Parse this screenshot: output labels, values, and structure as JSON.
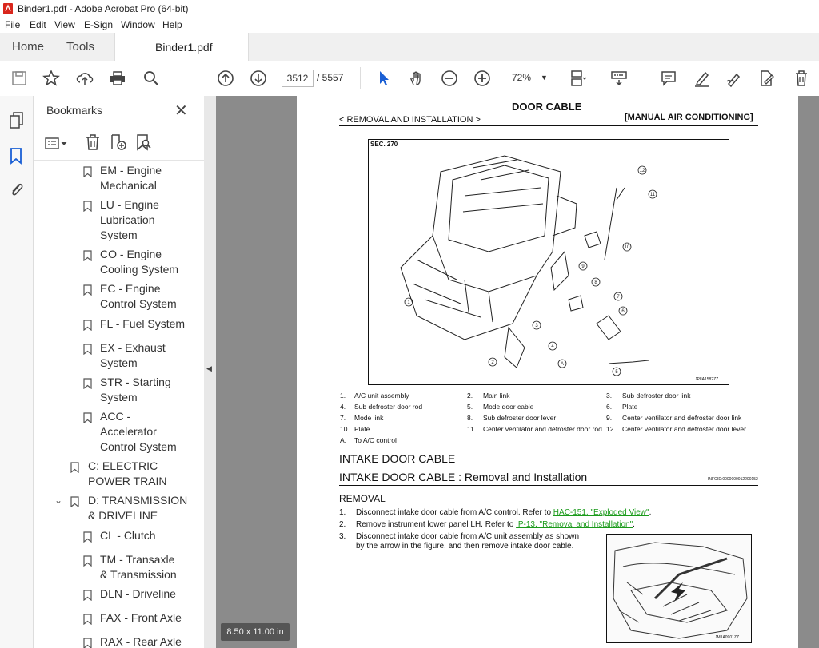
{
  "window": {
    "title": "Binder1.pdf - Adobe Acrobat Pro (64-bit)"
  },
  "menu": [
    "File",
    "Edit",
    "View",
    "E-Sign",
    "Window",
    "Help"
  ],
  "tabs": {
    "home": "Home",
    "tools": "Tools",
    "document": "Binder1.pdf"
  },
  "toolbar": {
    "page_current": "3512",
    "page_total": "/ 5557",
    "zoom": "72%"
  },
  "bookmarks": {
    "title": "Bookmarks",
    "items": [
      {
        "line1": "EM - Engine",
        "line2": "Mechanical"
      },
      {
        "line1": "LU - Engine",
        "line2": "Lubrication",
        "line3": "System"
      },
      {
        "line1": "CO - Engine",
        "line2": "Cooling System"
      },
      {
        "line1": "EC - Engine",
        "line2": "Control System"
      },
      {
        "line1": "FL - Fuel System"
      },
      {
        "line1": "EX - Exhaust",
        "line2": "System"
      },
      {
        "line1": "STR - Starting",
        "line2": "System"
      },
      {
        "line1": "ACC -",
        "line2": "Accelerator",
        "line3": "Control System"
      },
      {
        "line1": "C: ELECTRIC",
        "line2": "POWER TRAIN"
      },
      {
        "line1": "D: TRANSMISSION",
        "line2": "& DRIVELINE"
      },
      {
        "line1": "CL - Clutch"
      },
      {
        "line1": "TM - Transaxle",
        "line2": "& Transmission"
      },
      {
        "line1": "DLN - Driveline"
      },
      {
        "line1": "FAX - Front Axle"
      },
      {
        "line1": "RAX - Rear Axle"
      }
    ]
  },
  "page": {
    "heading": "DOOR CABLE",
    "breadcrumb": "< REMOVAL AND INSTALLATION >",
    "section": "[MANUAL AIR CONDITIONING]",
    "sec_label": "SEC. 270",
    "fig_id": "JPIIA1582ZZ",
    "legend": [
      [
        "1.",
        "A/C unit assembly",
        "2.",
        "Main link",
        "3.",
        "Sub defroster door link"
      ],
      [
        "4.",
        "Sub defroster door rod",
        "5.",
        "Mode door cable",
        "6.",
        "Plate"
      ],
      [
        "7.",
        "Mode link",
        "8.",
        "Sub defroster door lever",
        "9.",
        "Center ventilator and defroster door link"
      ],
      [
        "10.",
        "Plate",
        "11.",
        "Center ventilator and defroster door rod",
        "12.",
        "Center ventilator and defroster door lever"
      ],
      [
        "A.",
        "To A/C control",
        "",
        "",
        "",
        ""
      ]
    ],
    "intake_title": "INTAKE DOOR CABLE",
    "intake_sub": "INTAKE DOOR CABLE : Removal and Installation",
    "info_id": "INFOID:0000000012200152",
    "removal": "REMOVAL",
    "steps": [
      {
        "n": "1.",
        "text": "Disconnect intake door cable from A/C control. Refer to ",
        "link": "HAC-151, \"Exploded View\"",
        "end": "."
      },
      {
        "n": "2.",
        "text": "Remove instrument lower panel LH. Refer to ",
        "link": "IP-13, \"Removal and Installation\"",
        "end": "."
      },
      {
        "n": "3.",
        "text": "Disconnect intake door cable from A/C unit assembly as shown",
        "text2": "by the arrow in the figure, and then remove intake door cable."
      }
    ],
    "fig2_id": "JMIIA0901ZZ"
  },
  "status": {
    "page_size": "8.50 x 11.00 in"
  }
}
